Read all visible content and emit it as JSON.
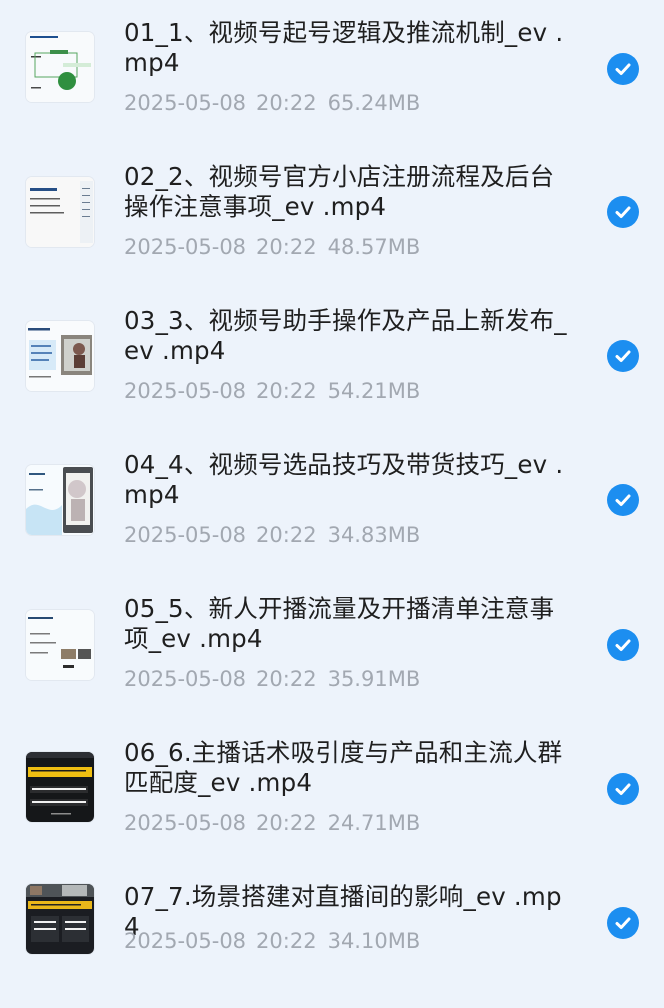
{
  "files": [
    {
      "name": "01_1、视频号起号逻辑及推流机制_ev .mp4",
      "date": "2025-05-08",
      "time": "20:22",
      "size": "65.24MB",
      "selected": true,
      "thumbnail": "flowchart-slide-thumbnail"
    },
    {
      "name": "02_2、视频号官方小店注册流程及后台操作注意事项_ev .mp4",
      "date": "2025-05-08",
      "time": "20:22",
      "size": "48.57MB",
      "selected": true,
      "thumbnail": "text-slide-thumbnail"
    },
    {
      "name": "03_3、视频号助手操作及产品上新发布_ev .mp4",
      "date": "2025-05-08",
      "time": "20:22",
      "size": "54.21MB",
      "selected": true,
      "thumbnail": "screenshot-slide-thumbnail"
    },
    {
      "name": "04_4、视频号选品技巧及带货技巧_ev .mp4",
      "date": "2025-05-08",
      "time": "20:22",
      "size": "34.83MB",
      "selected": true,
      "thumbnail": "phone-slide-thumbnail"
    },
    {
      "name": "05_5、新人开播流量及开播清单注意事项_ev .mp4",
      "date": "2025-05-08",
      "time": "20:22",
      "size": "35.91MB",
      "selected": true,
      "thumbnail": "checklist-slide-thumbnail"
    },
    {
      "name": "06_6.主播话术吸引度与产品和主流人群匹配度_ev .mp4",
      "date": "2025-05-08",
      "time": "20:22",
      "size": "24.71MB",
      "selected": true,
      "thumbnail": "dark-slide-thumbnail"
    },
    {
      "name": "07_7.场景搭建对直播间的影响_ev .mp4",
      "date": "2025-05-08",
      "time": "20:22",
      "size": "34.10MB",
      "selected": true,
      "thumbnail": "dark-photo-slide-thumbnail"
    }
  ],
  "colors": {
    "background": "#edf3fb",
    "checkmark": "#1c8ef0",
    "title": "#1f1f1f",
    "meta": "#a2a8b1"
  },
  "icons": {
    "selected": "checkmark-circle-icon"
  }
}
